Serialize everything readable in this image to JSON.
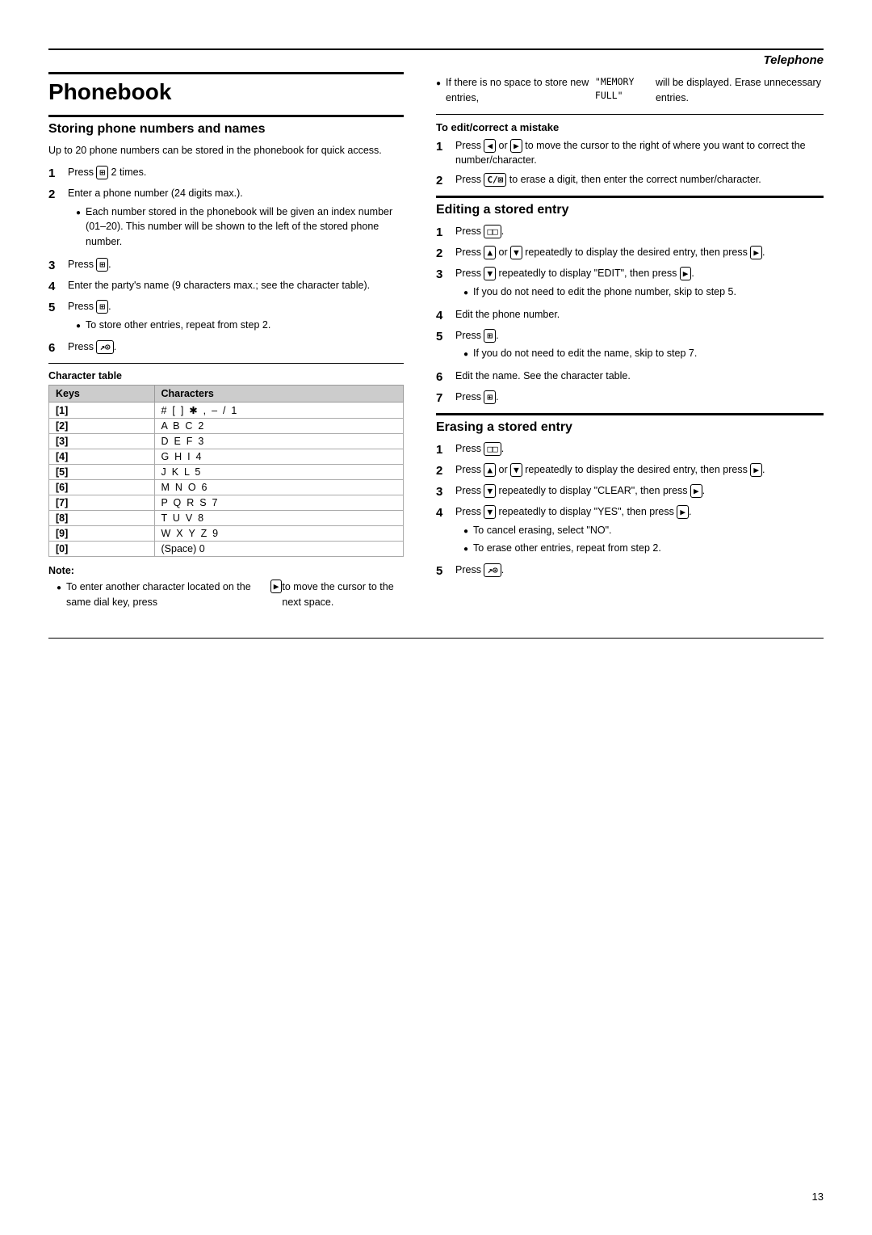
{
  "page": {
    "title": "Phonebook",
    "header_italic": "Telephone",
    "page_number": "13"
  },
  "left_col": {
    "storing_title": "Storing phone numbers and names",
    "storing_intro": "Up to 20 phone numbers can be stored in the phonebook for quick access.",
    "steps": [
      {
        "num": "1",
        "text": "Press",
        "key": "⊞",
        "suffix": "2 times."
      },
      {
        "num": "2",
        "text": "Enter a phone number (24 digits max.).",
        "bullets": [
          "Each number stored in the phonebook will be given an index number (01–20). This number will be shown to the left of the stored phone number."
        ]
      },
      {
        "num": "3",
        "text": "Press",
        "key": "⊞",
        "suffix": "."
      },
      {
        "num": "4",
        "text": "Enter the party's name (9 characters max.; see the character table)."
      },
      {
        "num": "5",
        "text": "Press",
        "key": "⊞",
        "suffix": ".",
        "bullets": [
          "To store other entries, repeat from step 2."
        ]
      },
      {
        "num": "6",
        "text": "Press",
        "key": "↗⊙",
        "suffix": "."
      }
    ],
    "char_table_label": "Character table",
    "char_table_headers": [
      "Keys",
      "Characters"
    ],
    "char_table_rows": [
      [
        "[1]",
        "# [ ] ✱ , – / 1"
      ],
      [
        "[2]",
        "A B C 2"
      ],
      [
        "[3]",
        "D E F 3"
      ],
      [
        "[4]",
        "G H I 4"
      ],
      [
        "[5]",
        "J K L 5"
      ],
      [
        "[6]",
        "M N O 6"
      ],
      [
        "[7]",
        "P Q R S 7"
      ],
      [
        "[8]",
        "T U V 8"
      ],
      [
        "[9]",
        "W X Y Z 9"
      ],
      [
        "[0]",
        "(Space) 0"
      ]
    ],
    "note_label": "Note:",
    "note_bullets": [
      "To enter another character located on the same dial key, press [ ▶ ] to move the cursor to the next space."
    ]
  },
  "right_col": {
    "memory_full_bullet": "If there is no space to store new entries, \"MEMORY FULL\" will be displayed. Erase unnecessary entries.",
    "edit_correct_label": "To edit/correct a mistake",
    "edit_steps": [
      {
        "num": "1",
        "text": "Press [ ◀ ] or [ ▶ ] to move the cursor to the right of where you want to correct the number/character."
      },
      {
        "num": "2",
        "text": "Press [C/⊠] to erase a digit, then enter the correct number/character."
      }
    ],
    "editing_title": "Editing a stored entry",
    "editing_steps": [
      {
        "num": "1",
        "text": "Press [□□]."
      },
      {
        "num": "2",
        "text": "Press [▲] or [▼] repeatedly to display the desired entry, then press [ ▶ ]."
      },
      {
        "num": "3",
        "text": "Press [▼] repeatedly to display \"EDIT\", then press [ ▶ ].",
        "bullets": [
          "If you do not need to edit the phone number, skip to step 5."
        ]
      },
      {
        "num": "4",
        "text": "Edit the phone number."
      },
      {
        "num": "5",
        "text": "Press [⊞].",
        "bullets": [
          "If you do not need to edit the name, skip to step 7."
        ]
      },
      {
        "num": "6",
        "text": "Edit the name. See the character table."
      },
      {
        "num": "7",
        "text": "Press [⊞]."
      }
    ],
    "erasing_title": "Erasing a stored entry",
    "erasing_steps": [
      {
        "num": "1",
        "text": "Press [□□]."
      },
      {
        "num": "2",
        "text": "Press [▲] or [▼] repeatedly to display the desired entry, then press [ ▶ ]."
      },
      {
        "num": "3",
        "text": "Press [▼] repeatedly to display \"CLEAR\", then press [ ▶ ]."
      },
      {
        "num": "4",
        "text": "Press [▼] repeatedly to display \"YES\", then press [ ▶ ].",
        "bullets": [
          "To cancel erasing, select \"NO\".",
          "To erase other entries, repeat from step 2."
        ]
      },
      {
        "num": "5",
        "text": "Press [↗⊙]."
      }
    ]
  }
}
